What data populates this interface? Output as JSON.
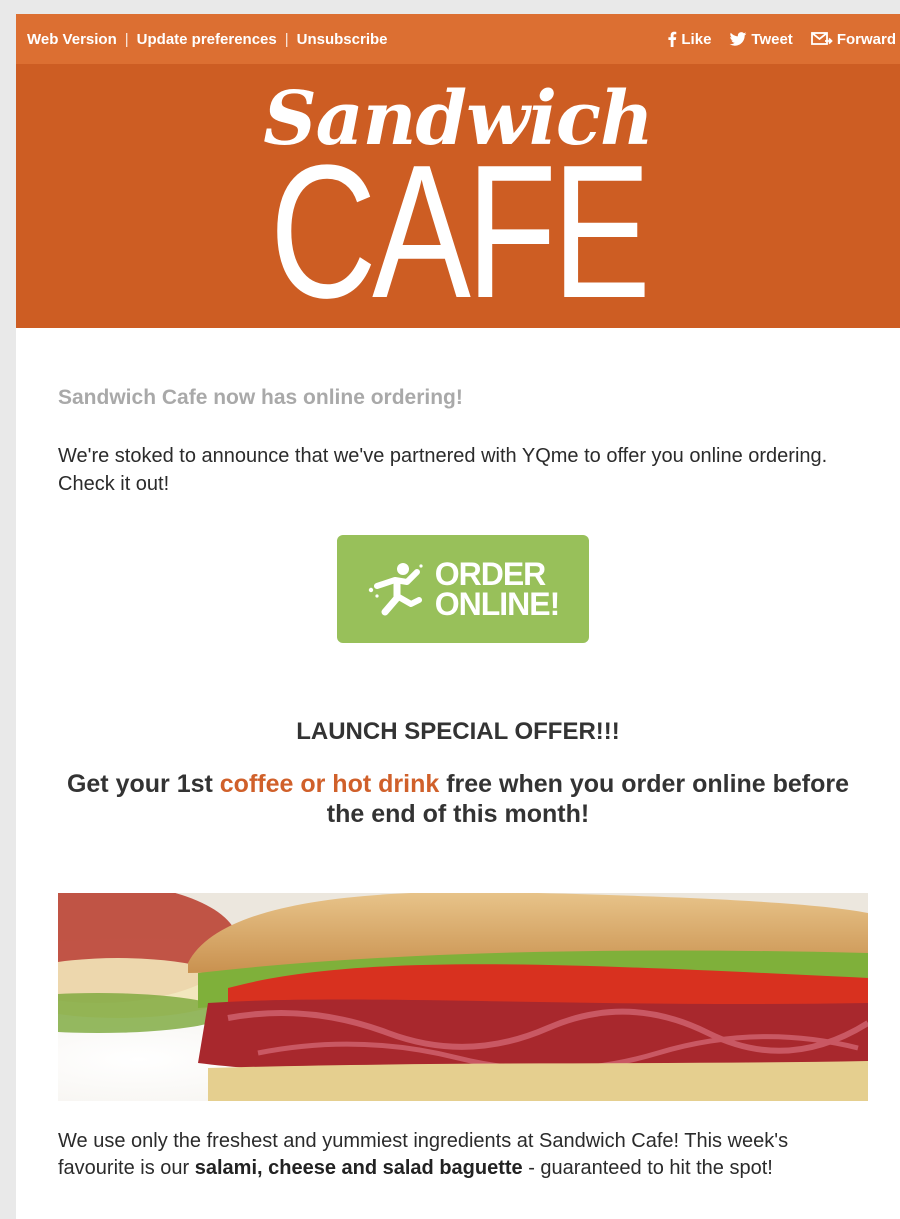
{
  "topbar": {
    "links": [
      "Web Version",
      "Update preferences",
      "Unsubscribe"
    ],
    "like_label": "Like",
    "tweet_label": "Tweet",
    "forward_label": "Forward"
  },
  "hero": {
    "logo_script": "Sandwich",
    "logo_cafe": "CAFE"
  },
  "content": {
    "subhead": "Sandwich Cafe now has online ordering!",
    "intro": "We're stoked to announce that we've partnered with YQme to offer you online ordering. Check it out!",
    "order_button": {
      "line1": "ORDER",
      "line2": "ONLINE!"
    },
    "launch_title": "LAUNCH SPECIAL OFFER!!!",
    "offer": {
      "pre": "Get your 1st ",
      "highlight": "coffee or hot drink",
      "post": " free when you order online before the end of this month!"
    },
    "footer": {
      "pre": "We use only the freshest and yummiest ingredients at Sandwich Cafe! This week's favourite is our ",
      "bold": "salami, cheese and salad baguette",
      "post": " - guaranteed to hit the spot!"
    }
  },
  "colors": {
    "topbar": "#dc6f32",
    "hero": "#cd5d23",
    "button": "#98c05a",
    "highlight": "#d0602a"
  }
}
